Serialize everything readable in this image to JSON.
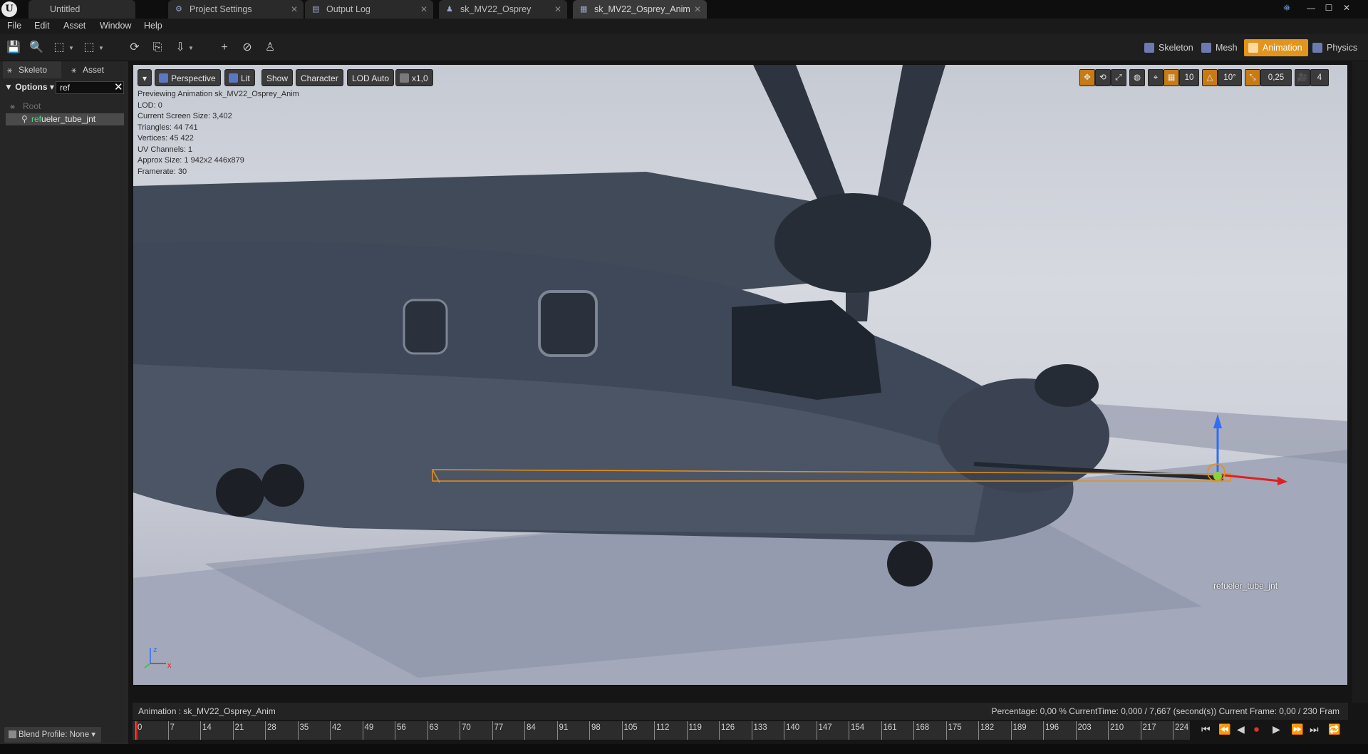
{
  "tabs": [
    {
      "label": "Untitled",
      "active": false
    },
    {
      "label": "Project Settings",
      "active": false
    },
    {
      "label": "Output Log",
      "active": false
    },
    {
      "label": "sk_MV22_Osprey",
      "active": false
    },
    {
      "label": "sk_MV22_Osprey_Anim",
      "active": true
    }
  ],
  "window_buttons": {
    "minimize": "—",
    "maximize": "☐",
    "close": "✕"
  },
  "menu": [
    "File",
    "Edit",
    "Asset",
    "Window",
    "Help"
  ],
  "modes": {
    "skeleton": "Skeleton",
    "mesh": "Mesh",
    "animation": "Animation",
    "physics": "Physics",
    "active_color": "#e2951c"
  },
  "left_panel": {
    "tab_skeleton": "Skeleto",
    "tab_asset": "Asset",
    "options": "Options",
    "search_value": "ref",
    "tree_root": "Root",
    "tree_item_match": "ref",
    "tree_item_rest": "ueler_tube_jnt",
    "blend_profile": "Blend Profile: None"
  },
  "viewport": {
    "perspective": "Perspective",
    "lit": "Lit",
    "show": "Show",
    "character": "Character",
    "lod": "LOD Auto",
    "speed": "x1,0",
    "grid_snap": "10",
    "rot_snap": "10°",
    "scale_snap": "0,25",
    "cam_speed": "4",
    "stats": [
      "Previewing Animation sk_MV22_Osprey_Anim",
      "LOD: 0",
      "Current Screen Size: 3,402",
      "Triangles: 44 741",
      "Vertices: 45 422",
      "UV Channels: 1",
      "Approx Size: 1 942x2 446x879",
      "Framerate: 30"
    ],
    "bone_label": "refueler_tube_jnt",
    "axis_x": "x",
    "axis_z": "z"
  },
  "timeline": {
    "animation_label": "Animation :  sk_MV22_Osprey_Anim",
    "stats": "Percentage:  0,00 % CurrentTime:  0,000 / 7,667 (second(s)) Current Frame:  0,00 / 230 Fram",
    "ticks": [
      "0",
      "7",
      "14",
      "21",
      "28",
      "35",
      "42",
      "49",
      "56",
      "63",
      "70",
      "77",
      "84",
      "91",
      "98",
      "105",
      "112",
      "119",
      "126",
      "133",
      "140",
      "147",
      "154",
      "161",
      "168",
      "175",
      "182",
      "189",
      "196",
      "203",
      "210",
      "217",
      "224"
    ]
  }
}
